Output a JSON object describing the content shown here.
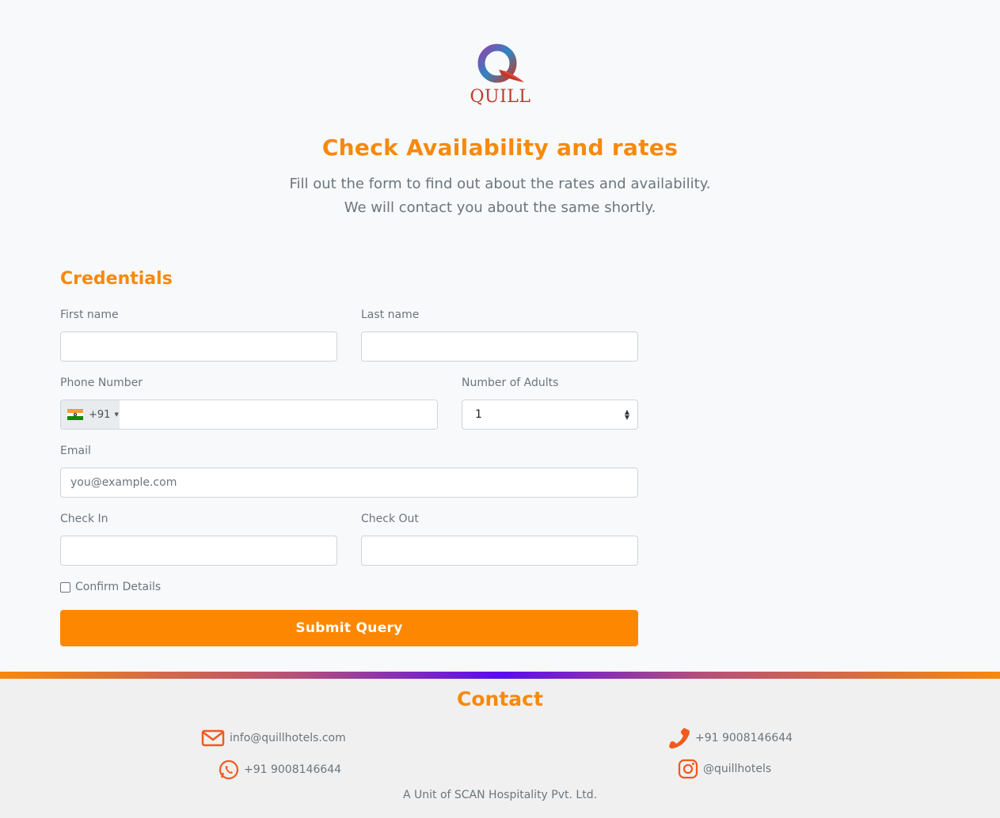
{
  "brand": {
    "logo_text": "QUILL",
    "accent": "#f7890c",
    "button": "#fd8700"
  },
  "hero": {
    "title": "Check Availability and rates",
    "line1": "Fill out the form to find out about the rates and availability.",
    "line2": "We will contact you about the same shortly."
  },
  "form": {
    "section_title": "Credentials",
    "first_name_label": "First name",
    "last_name_label": "Last name",
    "phone_label": "Phone Number",
    "phone_dial_code": "+91",
    "phone_flag": "india-flag-icon",
    "adults_label": "Number of Adults",
    "adults_value": "1",
    "email_label": "Email",
    "email_placeholder": "you@example.com",
    "checkin_label": "Check In",
    "checkout_label": "Check Out",
    "confirm_label": "Confirm Details",
    "submit_label": "Submit Query"
  },
  "footer": {
    "title": "Contact",
    "email": "info@quillhotels.com",
    "phone": "+91 9008146644",
    "whatsapp": "+91 9008146644",
    "instagram": "@quillhotels",
    "company": "A Unit of SCAN Hospitality Pvt. Ltd.",
    "icons": [
      "envelope-icon",
      "phone-icon",
      "whatsapp-icon",
      "instagram-icon"
    ]
  }
}
